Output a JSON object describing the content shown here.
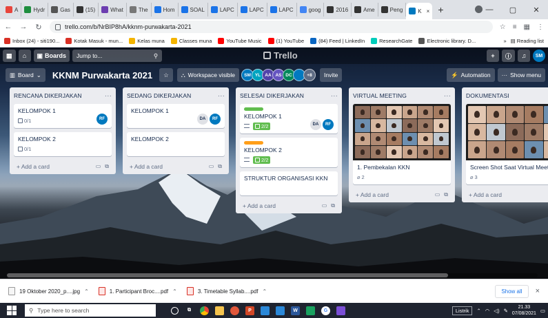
{
  "browser": {
    "tabs": [
      {
        "label": "A",
        "color": "#e8453c"
      },
      {
        "label": "Hydr",
        "color": "#1e8e3e"
      },
      {
        "label": "Gas",
        "color": "#555555"
      },
      {
        "label": "(15)",
        "color": "#333333"
      },
      {
        "label": "What",
        "color": "#6c3db0"
      },
      {
        "label": "The",
        "color": "#777777"
      },
      {
        "label": "Hom",
        "color": "#1a73e8"
      },
      {
        "label": "SOAL",
        "color": "#1a73e8"
      },
      {
        "label": "LAPC",
        "color": "#1a73e8"
      },
      {
        "label": "LAPC",
        "color": "#1a73e8"
      },
      {
        "label": "LAPC",
        "color": "#1a73e8"
      },
      {
        "label": "goog",
        "color": "#4285f4"
      },
      {
        "label": "2016",
        "color": "#333333"
      },
      {
        "label": "Ame",
        "color": "#333333"
      },
      {
        "label": "Peng",
        "color": "#333333"
      },
      {
        "label": "K",
        "color": "#0079bf"
      }
    ],
    "new_tab": "+",
    "url": "trello.com/b/NrBIP8hA/kknm-purwakarta-2021",
    "bookmarks": [
      {
        "label": "Inbox (24) - siti190...",
        "color": "#d93025"
      },
      {
        "label": "Kotak Masuk - mun...",
        "color": "#d93025"
      },
      {
        "label": "Kelas muna",
        "color": "#f4b400"
      },
      {
        "label": "Classes muna",
        "color": "#f4b400"
      },
      {
        "label": "YouTube Music",
        "color": "#ff0000"
      },
      {
        "label": "(1) YouTube",
        "color": "#ff0000"
      },
      {
        "label": "(84) Feed | LinkedIn",
        "color": "#0a66c2"
      },
      {
        "label": "ResearchGate",
        "color": "#00ccbb"
      },
      {
        "label": "Electronic library. D...",
        "color": "#555555"
      }
    ],
    "bookmarks_more": "»",
    "reading_list": "Reading list"
  },
  "trello": {
    "boards_label": "Boards",
    "jump_placeholder": "Jump to...",
    "logo": "Trello",
    "board_menu": "Board",
    "board_title": "KKNM Purwakarta 2021",
    "visibility": "Workspace visible",
    "members": [
      {
        "initials": "SM",
        "color": "#0079bf"
      },
      {
        "initials": "YL",
        "color": "#00a3bf"
      },
      {
        "initials": "AA",
        "color": "#5243aa"
      },
      {
        "initials": "AS",
        "color": "#6554c0"
      },
      {
        "initials": "DC",
        "color": "#00875a"
      },
      {
        "initials": "",
        "color": "#0079bf"
      },
      {
        "initials": "+8",
        "color": "#5e6c84"
      }
    ],
    "invite": "Invite",
    "automation": "Automation",
    "show_menu": "Show menu",
    "user_initials": "SM",
    "add_card": "+ Add a card",
    "lists": [
      {
        "title": "RENCANA DIKERJAKAN",
        "cards": [
          {
            "title": "KELOMPOK 1",
            "checklist": "0/1",
            "avatars": [
              "RF"
            ]
          },
          {
            "title": "KELOMPOK 2",
            "checklist": "0/1"
          }
        ]
      },
      {
        "title": "SEDANG DIKERJAKAN",
        "cards": [
          {
            "title": "KELOMPOK 1",
            "avatars": [
              "DA",
              "RF"
            ]
          },
          {
            "title": "KELOMPOK 2"
          }
        ]
      },
      {
        "title": "SELESAI DIKERJAKAN",
        "cards": [
          {
            "title": "KELOMPOK 1",
            "label_color": "#61bd4f",
            "checklist": "2/2",
            "avatars": [
              "DA",
              "RF"
            ]
          },
          {
            "title": "KELOMPOK 2",
            "label_color": "#ff9f1a",
            "checklist": "2/2"
          },
          {
            "title": "STRUKTUR ORGANISASI KKN"
          }
        ]
      },
      {
        "title": "VIRTUAL MEETING",
        "cards": [
          {
            "title": "1. Pembekalan KKN",
            "attachments": "2"
          }
        ]
      },
      {
        "title": "DOKUMENTASI",
        "cards": [
          {
            "title": "Screen Shot Saat Virtual Meeting",
            "attachments": "3"
          }
        ]
      }
    ]
  },
  "downloads": {
    "items": [
      {
        "name": "19 Oktober 2020_p....jpg",
        "type": "jpg"
      },
      {
        "name": "1. Participant Broc....pdf",
        "type": "pdf"
      },
      {
        "name": "3. Timetable Syllab....pdf",
        "type": "pdf"
      }
    ],
    "show_all": "Show all",
    "close": "×"
  },
  "taskbar": {
    "search_placeholder": "Type here to search",
    "listrik": "Listrik",
    "time": "21.33",
    "date": "07/08/2021"
  }
}
